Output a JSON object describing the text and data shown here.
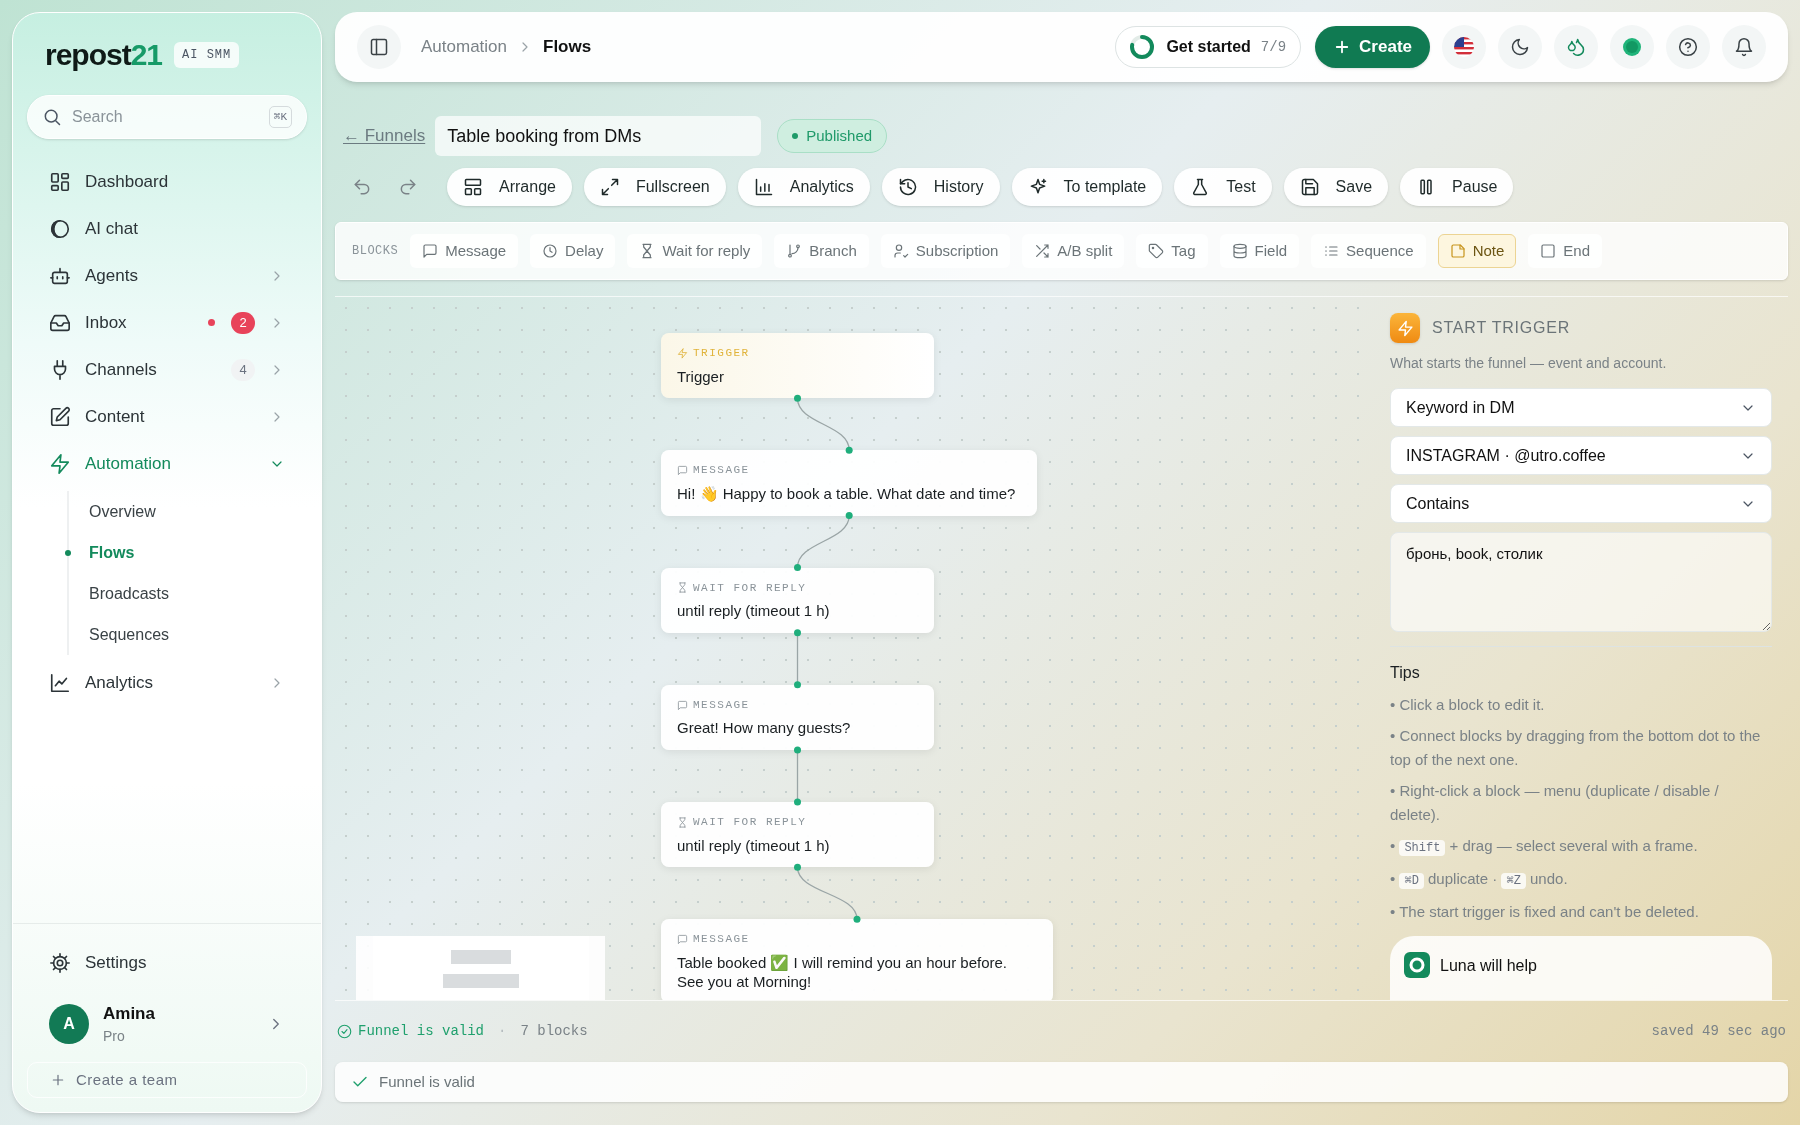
{
  "sidebar": {
    "logo": {
      "text": "repost",
      "accent": "21"
    },
    "badge": "AI SMM",
    "search": {
      "placeholder": "Search",
      "shortcut": "⌘K"
    },
    "nav": [
      {
        "label": "Dashboard",
        "kind": "link",
        "selected": false,
        "unread": false
      },
      {
        "label": "AI chat",
        "kind": "link",
        "selected": false,
        "unread": false
      },
      {
        "label": "Agents",
        "kind": "group",
        "selected": false,
        "expanded": false,
        "unread": false
      },
      {
        "label": "Inbox",
        "kind": "group",
        "selected": false,
        "expanded": false,
        "unread": true,
        "badge": {
          "text": "2"
        }
      },
      {
        "label": "Channels",
        "kind": "group",
        "selected": false,
        "expanded": false,
        "unread": false,
        "badge": {
          "text": "4"
        }
      },
      {
        "label": "Content",
        "kind": "group",
        "selected": false,
        "expanded": false,
        "unread": false
      },
      {
        "label": "Automation",
        "kind": "group",
        "selected": true,
        "expanded": true,
        "unread": false,
        "children": [
          {
            "label": "Overview",
            "selected": false
          },
          {
            "label": "Flows",
            "selected": true
          },
          {
            "label": "Broadcasts",
            "selected": false
          },
          {
            "label": "Sequences",
            "selected": false
          }
        ]
      },
      {
        "label": "Analytics",
        "kind": "group",
        "selected": false,
        "expanded": false,
        "unread": false
      }
    ],
    "settings": "Settings",
    "user": {
      "initial": "A",
      "name": "Amina",
      "plan": "Pro"
    },
    "create_team": "Create a team"
  },
  "topbar": {
    "breadcrumb": [
      "Automation",
      "Flows"
    ],
    "progress": {
      "label": "Get started",
      "count": "7/9"
    },
    "create": "Create"
  },
  "editor": {
    "back": "← Funnels",
    "title": "Table booking from DMs",
    "status": "Published",
    "toolbar": [
      "Arrange",
      "Fullscreen",
      "Analytics",
      "History",
      "To template",
      "Test",
      "Save",
      "Pause"
    ],
    "blocks": {
      "label": "BLOCKS",
      "items": [
        {
          "label": "Message",
          "selected": false
        },
        {
          "label": "Delay",
          "selected": false
        },
        {
          "label": "Wait for reply",
          "selected": false
        },
        {
          "label": "Branch",
          "selected": false
        },
        {
          "label": "Subscription",
          "selected": false
        },
        {
          "label": "A/B split",
          "selected": false
        },
        {
          "label": "Tag",
          "selected": false
        },
        {
          "label": "Field",
          "selected": false
        },
        {
          "label": "Sequence",
          "selected": false
        },
        {
          "label": "Note",
          "selected": true
        },
        {
          "label": "End",
          "selected": false
        }
      ]
    },
    "nodes": [
      {
        "kind": "trigger",
        "tag": "TRIGGER",
        "text": "Trigger"
      },
      {
        "kind": "message",
        "tag": "MESSAGE",
        "text": "Hi! 👋 Happy to book a table. What date and time?"
      },
      {
        "kind": "wait",
        "tag": "WAIT FOR REPLY",
        "text": "until reply (timeout 1 h)"
      },
      {
        "kind": "message",
        "tag": "MESSAGE",
        "text": "Great! How many guests?"
      },
      {
        "kind": "wait",
        "tag": "WAIT FOR REPLY",
        "text": "until reply (timeout 1 h)"
      },
      {
        "kind": "message",
        "tag": "MESSAGE",
        "text": "Table booked ✅ I will remind you an hour before. See you at Morning!"
      }
    ],
    "panel": {
      "title": "START TRIGGER",
      "subtitle": "What starts the funnel — event and account.",
      "selects": [
        "Keyword in DM",
        "INSTAGRAM · @utro.coffee",
        "Contains"
      ],
      "keywords": "бронь, book, столик",
      "tips_title": "Tips",
      "tips": [
        [
          {
            "kind": "text",
            "text": "• Click a block to edit it."
          }
        ],
        [
          {
            "kind": "text",
            "text": "• Connect blocks by dragging from the bottom dot to the top of the next one."
          }
        ],
        [
          {
            "kind": "text",
            "text": "• Right-click a block — menu (duplicate / disable / delete)."
          }
        ],
        [
          {
            "kind": "text",
            "text": "• "
          },
          {
            "kind": "key",
            "text": "Shift"
          },
          {
            "kind": "text",
            "text": " + drag — select several with a frame."
          }
        ],
        [
          {
            "kind": "text",
            "text": "• "
          },
          {
            "kind": "key",
            "text": "⌘D"
          },
          {
            "kind": "text",
            "text": " duplicate · "
          },
          {
            "kind": "key",
            "text": "⌘Z"
          },
          {
            "kind": "text",
            "text": " undo."
          }
        ],
        [
          {
            "kind": "text",
            "text": "• The start trigger is fixed and can't be deleted."
          }
        ]
      ],
      "helper": "Luna will help"
    },
    "footer": {
      "valid": "Funnel is valid",
      "separator": "·",
      "blocks": "7 blocks",
      "saved": "saved 49 sec ago"
    },
    "validation": "Funnel is valid"
  }
}
